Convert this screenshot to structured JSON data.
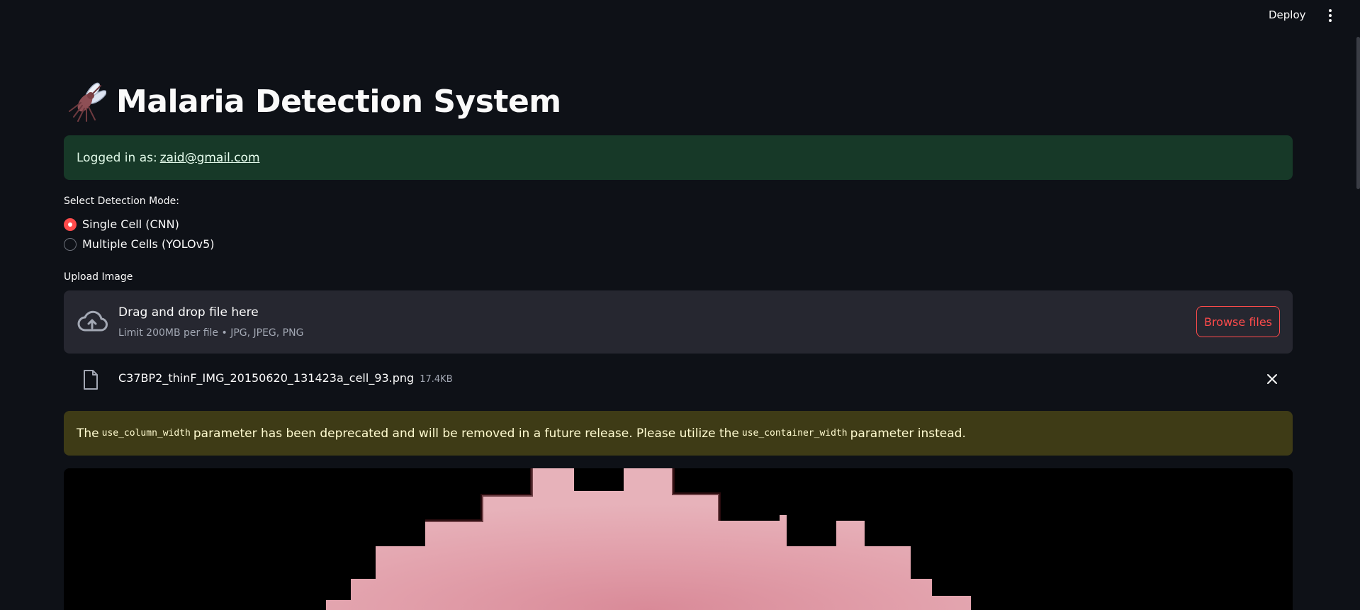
{
  "header": {
    "deploy_label": "Deploy",
    "menu_icon": "vertical-ellipsis-icon"
  },
  "page": {
    "title": "Malaria Detection System",
    "title_icon": "mosquito-emoji"
  },
  "login": {
    "prefix": "Logged in as:",
    "email": "zaid@gmail.com"
  },
  "detection_mode": {
    "label": "Select Detection Mode:",
    "options": [
      {
        "label": "Single Cell (CNN)",
        "selected": true
      },
      {
        "label": "Multiple Cells (YOLOv5)",
        "selected": false
      }
    ]
  },
  "upload": {
    "label": "Upload Image",
    "drop_title": "Drag and drop file here",
    "drop_subtitle": "Limit 200MB per file • JPG, JPEG, PNG",
    "browse_label": "Browse files",
    "file": {
      "name": "C37BP2_thinF_IMG_20150620_131423a_cell_93.png",
      "size": "17.4KB"
    }
  },
  "warning": {
    "part1": "The",
    "code1": "use_column_width",
    "part2": "parameter has been deprecated and will be removed in a future release. Please utilize the",
    "code2": "use_container_width",
    "part3": "parameter instead."
  },
  "colors": {
    "background": "#0e1117",
    "accent": "#ff4b4b",
    "success_bg": "#173928",
    "warning_bg": "#3e3b16"
  }
}
